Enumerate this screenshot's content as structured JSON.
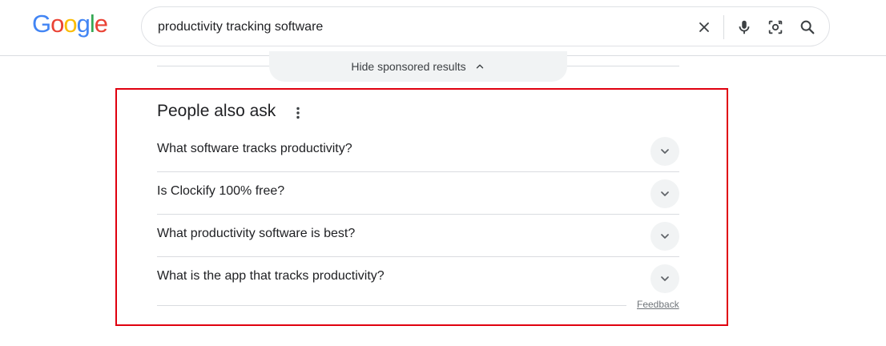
{
  "logo": {
    "letters": [
      {
        "ch": "G",
        "color": "#4285F4"
      },
      {
        "ch": "o",
        "color": "#EA4335"
      },
      {
        "ch": "o",
        "color": "#FBBC05"
      },
      {
        "ch": "g",
        "color": "#4285F4"
      },
      {
        "ch": "l",
        "color": "#34A853"
      },
      {
        "ch": "e",
        "color": "#EA4335"
      }
    ]
  },
  "search": {
    "query": "productivity tracking software",
    "icons": [
      "close-icon",
      "microphone-icon",
      "lens-camera-icon",
      "search-icon"
    ]
  },
  "sponsored": {
    "toggle_label": "Hide sponsored results",
    "icon": "chevron-up-icon"
  },
  "paa": {
    "title": "People also ask",
    "menu_icon": "more-vert-icon",
    "questions": [
      {
        "text": "What software tracks productivity?"
      },
      {
        "text": "Is Clockify 100% free?"
      },
      {
        "text": "What productivity software is best?"
      },
      {
        "text": "What is the app that tracks productivity?"
      }
    ],
    "feedback_label": "Feedback"
  },
  "colors": {
    "highlight_border": "#e0000f",
    "chip_bg": "#f1f3f4",
    "divider": "#dadce0"
  }
}
